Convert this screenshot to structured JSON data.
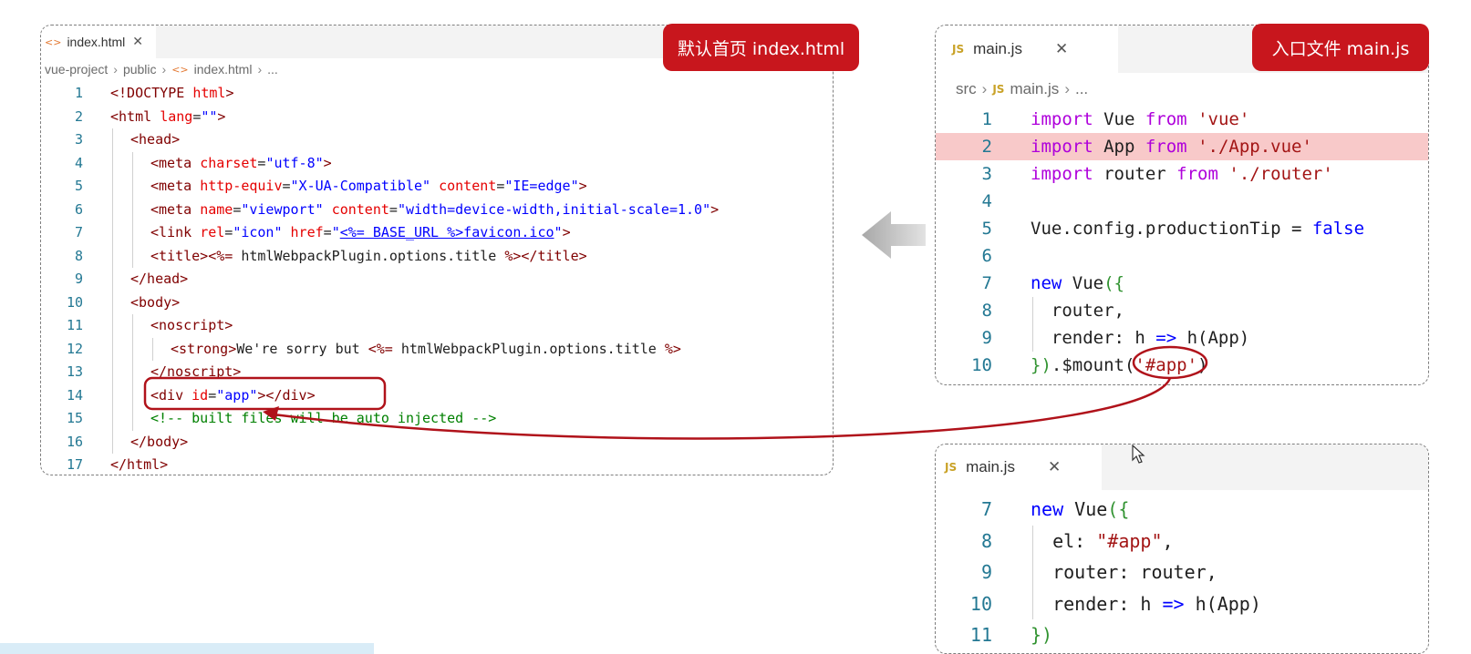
{
  "left_panel": {
    "tab_icon": "<>",
    "tab_name": "index.html",
    "tab_close": "✕",
    "badge": "默认首页 index.html",
    "breadcrumb": [
      "vue-project",
      "public",
      "index.html",
      "..."
    ],
    "lines": [
      {
        "n": "1",
        "tokens": [
          [
            "t",
            "<!DOCTYPE "
          ],
          [
            "a",
            "html"
          ],
          [
            "t",
            ">"
          ]
        ]
      },
      {
        "n": "2",
        "tokens": [
          [
            "t",
            "<html "
          ],
          [
            "a",
            "lang"
          ],
          [
            "p",
            "="
          ],
          [
            "v",
            "\"\""
          ],
          [
            "t",
            ">"
          ]
        ]
      },
      {
        "n": "3",
        "tokens": [
          [
            "t",
            "<head>"
          ]
        ]
      },
      {
        "n": "4",
        "tokens": [
          [
            "t",
            "<meta "
          ],
          [
            "a",
            "charset"
          ],
          [
            "p",
            "="
          ],
          [
            "v",
            "\"utf-8\""
          ],
          [
            "t",
            ">"
          ]
        ]
      },
      {
        "n": "5",
        "tokens": [
          [
            "t",
            "<meta "
          ],
          [
            "a",
            "http-equiv"
          ],
          [
            "p",
            "="
          ],
          [
            "v",
            "\"X-UA-Compatible\""
          ],
          [
            "p",
            " "
          ],
          [
            "a",
            "content"
          ],
          [
            "p",
            "="
          ],
          [
            "v",
            "\"IE=edge\""
          ],
          [
            "t",
            ">"
          ]
        ]
      },
      {
        "n": "6",
        "tokens": [
          [
            "t",
            "<meta "
          ],
          [
            "a",
            "name"
          ],
          [
            "p",
            "="
          ],
          [
            "v",
            "\"viewport\""
          ],
          [
            "p",
            " "
          ],
          [
            "a",
            "content"
          ],
          [
            "p",
            "="
          ],
          [
            "v",
            "\"width=device-width,initial-scale=1.0\""
          ],
          [
            "t",
            ">"
          ]
        ]
      },
      {
        "n": "7",
        "tokens": [
          [
            "t",
            "<link "
          ],
          [
            "a",
            "rel"
          ],
          [
            "p",
            "="
          ],
          [
            "v",
            "\"icon\""
          ],
          [
            "p",
            " "
          ],
          [
            "a",
            "href"
          ],
          [
            "p",
            "="
          ],
          [
            "v",
            "\""
          ],
          [
            "u",
            "<%= BASE_URL %>favicon.ico"
          ],
          [
            "v",
            "\""
          ],
          [
            "t",
            ">"
          ]
        ]
      },
      {
        "n": "8",
        "tokens": [
          [
            "t",
            "<title>"
          ],
          [
            "d",
            "<%= "
          ],
          [
            "p",
            "htmlWebpackPlugin.options.title "
          ],
          [
            "d",
            "%>"
          ],
          [
            "t",
            "</title>"
          ]
        ]
      },
      {
        "n": "9",
        "tokens": [
          [
            "t",
            "</head>"
          ]
        ]
      },
      {
        "n": "10",
        "tokens": [
          [
            "t",
            "<body>"
          ]
        ]
      },
      {
        "n": "11",
        "tokens": [
          [
            "t",
            "<noscript>"
          ]
        ]
      },
      {
        "n": "12",
        "tokens": [
          [
            "t",
            "<strong>"
          ],
          [
            "p",
            "We're sorry but "
          ],
          [
            "d",
            "<%= "
          ],
          [
            "p",
            "htmlWebpackPlugin.options.title "
          ],
          [
            "d",
            "%>"
          ]
        ]
      },
      {
        "n": "13",
        "tokens": [
          [
            "t",
            "</noscript>"
          ]
        ]
      },
      {
        "n": "14",
        "tokens": [
          [
            "t",
            "<div "
          ],
          [
            "a",
            "id"
          ],
          [
            "p",
            "="
          ],
          [
            "v",
            "\"app\""
          ],
          [
            "t",
            "></div>"
          ]
        ]
      },
      {
        "n": "15",
        "tokens": [
          [
            "c",
            "<!-- built files will be auto injected -->"
          ]
        ]
      },
      {
        "n": "16",
        "tokens": [
          [
            "t",
            "</body>"
          ]
        ]
      },
      {
        "n": "17",
        "tokens": [
          [
            "t",
            "</html>"
          ]
        ]
      }
    ]
  },
  "right_top_panel": {
    "tab_icon": "JS",
    "tab_name": "main.js",
    "tab_close": "✕",
    "badge": "入口文件 main.js",
    "breadcrumb": [
      "src",
      "main.js",
      "..."
    ],
    "lines": [
      {
        "n": "1",
        "tokens": [
          [
            "kp",
            "import"
          ],
          [
            "fn",
            " Vue "
          ],
          [
            "kp",
            "from"
          ],
          [
            "fn",
            " "
          ],
          [
            "s",
            "'vue'"
          ]
        ]
      },
      {
        "n": "2",
        "tokens": [
          [
            "kp",
            "import"
          ],
          [
            "fn",
            " App "
          ],
          [
            "kp",
            "from"
          ],
          [
            "fn",
            " "
          ],
          [
            "s",
            "'./App.vue'"
          ]
        ]
      },
      {
        "n": "3",
        "tokens": [
          [
            "kp",
            "import"
          ],
          [
            "fn",
            " router "
          ],
          [
            "kp",
            "from"
          ],
          [
            "fn",
            " "
          ],
          [
            "s",
            "'./router'"
          ]
        ]
      },
      {
        "n": "4",
        "tokens": []
      },
      {
        "n": "5",
        "tokens": [
          [
            "fn",
            "Vue.config.productionTip = "
          ],
          [
            "k",
            "false"
          ]
        ]
      },
      {
        "n": "6",
        "tokens": []
      },
      {
        "n": "7",
        "tokens": [
          [
            "k",
            "new"
          ],
          [
            "fn",
            " Vue"
          ],
          [
            "br",
            "({"
          ]
        ]
      },
      {
        "n": "8",
        "tokens": [
          [
            "fn",
            "  router,"
          ]
        ]
      },
      {
        "n": "9",
        "tokens": [
          [
            "fn",
            "  render: h "
          ],
          [
            "k",
            "=>"
          ],
          [
            "fn",
            " h(App)"
          ]
        ]
      },
      {
        "n": "10",
        "tokens": [
          [
            "br",
            "})"
          ],
          [
            "fn",
            ".$mount("
          ],
          [
            "s",
            "'#app'"
          ],
          [
            "fn",
            ")"
          ]
        ]
      }
    ]
  },
  "right_bottom_panel": {
    "tab_icon": "JS",
    "tab_name": "main.js",
    "tab_close": "✕",
    "lines": [
      {
        "n": "7",
        "tokens": [
          [
            "k",
            "new"
          ],
          [
            "fn",
            " Vue"
          ],
          [
            "br",
            "({"
          ]
        ]
      },
      {
        "n": "8",
        "tokens": [
          [
            "fn",
            "  el: "
          ],
          [
            "s",
            "\"#app\""
          ],
          [
            "fn",
            ","
          ]
        ]
      },
      {
        "n": "9",
        "tokens": [
          [
            "fn",
            "  router: router,"
          ]
        ]
      },
      {
        "n": "10",
        "tokens": [
          [
            "fn",
            "  render: h "
          ],
          [
            "k",
            "=>"
          ],
          [
            "fn",
            " h(App)"
          ]
        ]
      },
      {
        "n": "11",
        "tokens": [
          [
            "br",
            "})"
          ]
        ]
      }
    ]
  },
  "colors": {
    "badge_red": "#c8161d",
    "highlight_row": "#f8c9c9",
    "annotation_red": "#b0121a",
    "arrow_gray": "#c9c9c9"
  },
  "icons": [
    "html-file-icon",
    "js-file-icon",
    "close-icon",
    "left-arrow-icon",
    "mouse-cursor-icon"
  ]
}
